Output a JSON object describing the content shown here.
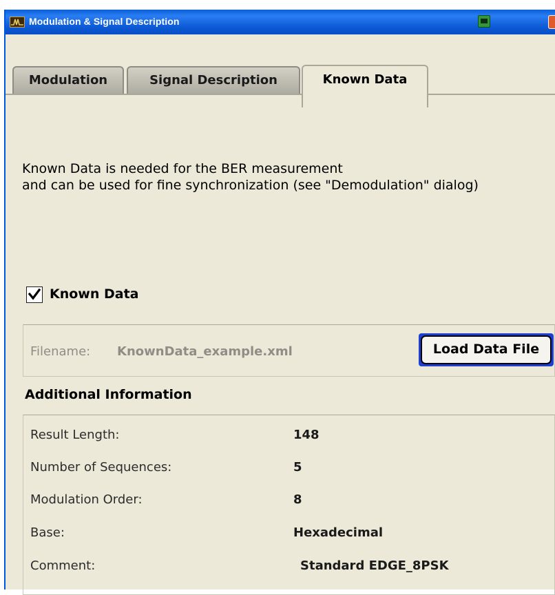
{
  "window": {
    "title": "Modulation & Signal Description"
  },
  "icons": {
    "app": "waveform-app-icon",
    "print": "printer-icon",
    "close": "close-icon",
    "check": "check-icon"
  },
  "tabs": [
    {
      "label": "Modulation",
      "active": false
    },
    {
      "label": "Signal Description",
      "active": false
    },
    {
      "label": "Known Data",
      "active": true
    }
  ],
  "description": {
    "line1": "Known Data is needed for the BER measurement",
    "line2": "and can be used for fine synchronization (see \"Demodulation\" dialog)"
  },
  "known_data_checkbox": {
    "label": "Known Data",
    "checked": true
  },
  "file": {
    "label": "Filename:",
    "value": "KnownData_example.xml",
    "load_button": "Load Data File"
  },
  "additional_info": {
    "title": "Additional Information",
    "rows": [
      {
        "label": "Result Length:",
        "value": "148"
      },
      {
        "label": "Number of Sequences:",
        "value": "5"
      },
      {
        "label": "Modulation Order:",
        "value": "8"
      },
      {
        "label": "Base:",
        "value": "Hexadecimal"
      },
      {
        "label": "Comment:",
        "value": "Standard EDGE_8PSK"
      }
    ]
  },
  "colors": {
    "titlebar": "#0a5fd8",
    "dialog_bg": "#ece9d8",
    "focus_border": "#1d3fd2",
    "disabled_text": "#8f8d86"
  }
}
